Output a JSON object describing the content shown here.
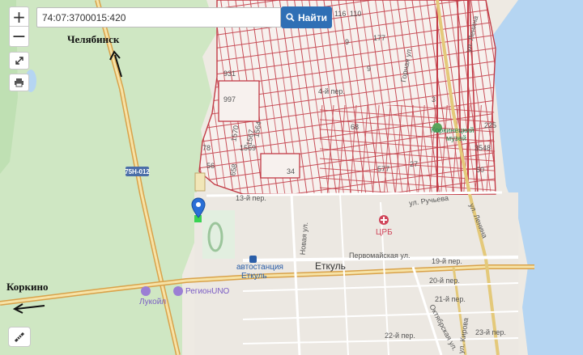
{
  "search": {
    "value": "74:07:3700015:420",
    "button_label": "Найти"
  },
  "controls": {
    "zoom_in": "+",
    "zoom_out": "−"
  },
  "labels": {
    "chelyabinsk": "Челябинск",
    "korkino": "Коркино",
    "etkul": "Еткуль",
    "bus_station_line1": "автостанция",
    "bus_station_line2": "Еткуль",
    "hospital": "ЦРБ",
    "regionuno": "РегионUNO",
    "lukoil": "Лукойл",
    "museum_line1": "Коркинецкий",
    "museum_line2": "музей",
    "road_shield": "75Н-012",
    "streets": {
      "lenina_north": "ул. Ленина",
      "lenina_south": "ул. Ленина",
      "rucheva": "ул. Ручьева",
      "pervomaiskaya": "Первомайская ул.",
      "novaya": "Новая ул.",
      "oktyabrskaya": "Октябрская ул.",
      "kirova": "ул. Кирова",
      "gornaya": "Горная ул.",
      "per13": "13-й пер.",
      "per19": "19-й пер.",
      "per20": "20-й пер.",
      "per21": "21-й пер.",
      "per22": "22-й пер.",
      "per23": "23-й пер.",
      "per4": "4-й пер."
    },
    "parcels": [
      "931",
      "997",
      "1570",
      "1564",
      "1569",
      "1567",
      "78",
      "56",
      "658",
      "34",
      "68",
      "577",
      "27",
      "177",
      "116",
      "110",
      "9",
      "3",
      "225",
      "3548",
      "50",
      "9"
    ]
  }
}
